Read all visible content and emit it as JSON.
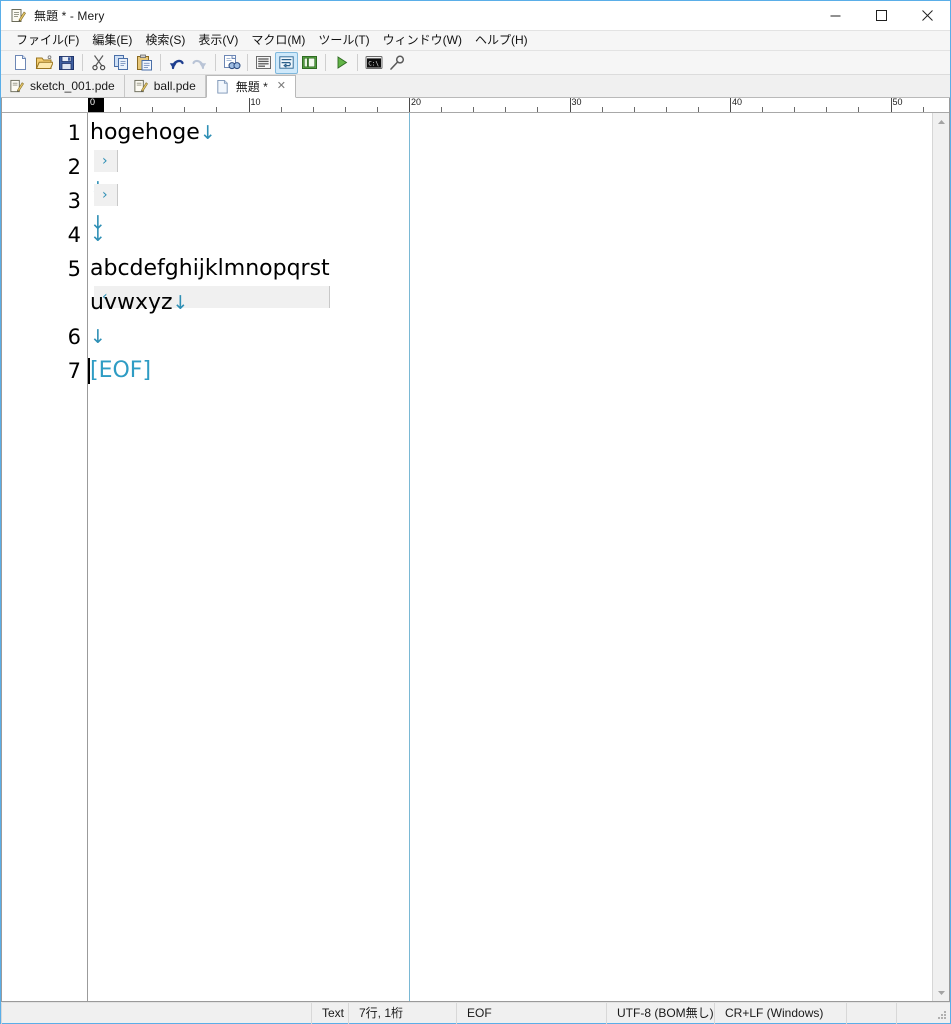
{
  "window": {
    "title": "無題 * - Mery",
    "app_icon": "mery-document-pencil-icon",
    "controls": {
      "minimize": "minimize-icon",
      "maximize": "maximize-icon",
      "close": "close-icon"
    }
  },
  "menubar": {
    "items": [
      {
        "label": "ファイル(F)",
        "name": "menu-file"
      },
      {
        "label": "編集(E)",
        "name": "menu-edit"
      },
      {
        "label": "検索(S)",
        "name": "menu-search"
      },
      {
        "label": "表示(V)",
        "name": "menu-view"
      },
      {
        "label": "マクロ(M)",
        "name": "menu-macro"
      },
      {
        "label": "ツール(T)",
        "name": "menu-tools"
      },
      {
        "label": "ウィンドウ(W)",
        "name": "menu-window"
      },
      {
        "label": "ヘルプ(H)",
        "name": "menu-help"
      }
    ]
  },
  "toolbar": {
    "buttons": [
      {
        "name": "new-file-icon",
        "title": "新規"
      },
      {
        "name": "open-folder-icon",
        "title": "開く"
      },
      {
        "name": "save-icon",
        "title": "保存"
      },
      {
        "name": "separator-1",
        "separator": true
      },
      {
        "name": "cut-scissors-icon",
        "title": "切り取り"
      },
      {
        "name": "copy-icon",
        "title": "コピー"
      },
      {
        "name": "paste-clipboard-icon",
        "title": "貼り付け"
      },
      {
        "name": "separator-2",
        "separator": true
      },
      {
        "name": "undo-arrow-icon",
        "title": "元に戻す"
      },
      {
        "name": "redo-arrow-icon",
        "title": "やり直し"
      },
      {
        "name": "separator-3",
        "separator": true
      },
      {
        "name": "find-binoculars-icon",
        "title": "検索"
      },
      {
        "name": "separator-4",
        "separator": true
      },
      {
        "name": "line-numbers-icon",
        "title": "行番号"
      },
      {
        "name": "word-wrap-icon",
        "title": "折り返し",
        "active": true
      },
      {
        "name": "outline-panel-icon",
        "title": "アウトライン"
      },
      {
        "name": "separator-5",
        "separator": true
      },
      {
        "name": "run-play-icon",
        "title": "実行"
      },
      {
        "name": "separator-6",
        "separator": true
      },
      {
        "name": "console-cmd-icon",
        "title": "コマンドプロンプト"
      },
      {
        "name": "pin-tool-icon",
        "title": "ツール"
      }
    ]
  },
  "tabs": [
    {
      "label": "sketch_001.pde",
      "icon": "mery-document-pencil-icon",
      "active": false,
      "closable": false
    },
    {
      "label": "ball.pde",
      "icon": "mery-document-pencil-icon",
      "active": false,
      "closable": false
    },
    {
      "label": "無題 *",
      "icon": "blank-document-icon",
      "active": true,
      "closable": true,
      "close_glyph": "✕"
    }
  ],
  "editor": {
    "ruler": {
      "labels": [
        "0",
        "10",
        "20",
        "30",
        "40",
        "50"
      ],
      "col_width": 16.05,
      "highlight_column": 0
    },
    "guide_column": 20,
    "gutter_numbers": [
      "1",
      "2",
      "3",
      "4",
      "5",
      "6",
      "7"
    ],
    "lines": [
      {
        "number": "1",
        "text": "hogehoge",
        "tab_marker": "",
        "eol_marker": "↓",
        "wrap_marker": ""
      },
      {
        "number": "2",
        "text": "",
        "tab_marker": "›",
        "eol_marker": "↓",
        "wrap_marker": ""
      },
      {
        "number": "3",
        "text": "",
        "tab_marker": "›",
        "eol_marker": "↓",
        "wrap_marker": ""
      },
      {
        "number": "4",
        "text": "",
        "tab_marker": "",
        "eol_marker": "↓",
        "wrap_marker": ""
      },
      {
        "number": "5",
        "text": "abcdefghijklmnopqrst",
        "tab_marker": "",
        "eol_marker": "",
        "wrap_marker": "‹"
      },
      {
        "number": "",
        "text": "uvwxyz",
        "tab_marker": "",
        "eol_marker": "↓",
        "wrap_marker": ""
      },
      {
        "number": "6",
        "text": "",
        "tab_marker": "",
        "eol_marker": "↓",
        "wrap_marker": ""
      },
      {
        "number": "7",
        "text": "[EOF]",
        "tab_marker": "",
        "eol_marker": "",
        "wrap_marker": "",
        "is_eof": true
      }
    ],
    "colors": {
      "marker": "#2e8fb5",
      "eof_text": "#2e9cc4",
      "guide": "#7ab8d4",
      "text": "#000000"
    }
  },
  "scrollbar": {
    "up_arrow": "scroll-up-icon",
    "down_arrow": "scroll-down-icon"
  },
  "statusbar": {
    "type": "Text",
    "cursor": "7行, 1桁",
    "eol_state": "EOF",
    "encoding": "UTF-8 (BOM無し)",
    "linebreak": "CR+LF (Windows)",
    "extra_1": "",
    "extra_2": ""
  }
}
